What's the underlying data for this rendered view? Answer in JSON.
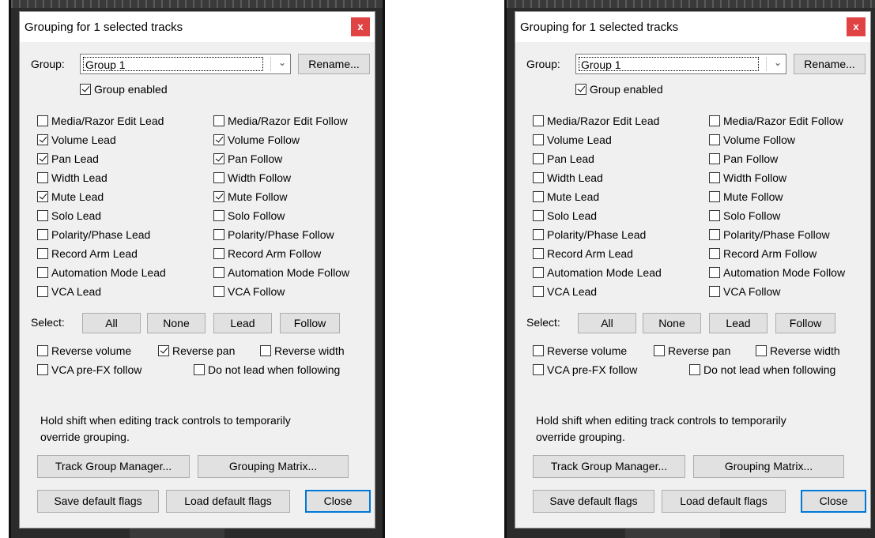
{
  "panels": [
    {
      "title": "Grouping for 1 selected tracks",
      "close_glyph": "x",
      "group_label": "Group:",
      "group_value": "Group 1",
      "rename_label": "Rename...",
      "group_enabled": {
        "label": "Group enabled",
        "checked": true
      },
      "flags": [
        {
          "lead": {
            "label": "Media/Razor Edit Lead",
            "checked": false
          },
          "follow": {
            "label": "Media/Razor Edit Follow",
            "checked": false
          }
        },
        {
          "lead": {
            "label": "Volume Lead",
            "checked": true
          },
          "follow": {
            "label": "Volume Follow",
            "checked": true
          }
        },
        {
          "lead": {
            "label": "Pan Lead",
            "checked": true
          },
          "follow": {
            "label": "Pan Follow",
            "checked": true
          }
        },
        {
          "lead": {
            "label": "Width Lead",
            "checked": false
          },
          "follow": {
            "label": "Width Follow",
            "checked": false
          }
        },
        {
          "lead": {
            "label": "Mute Lead",
            "checked": true
          },
          "follow": {
            "label": "Mute Follow",
            "checked": true
          }
        },
        {
          "lead": {
            "label": "Solo Lead",
            "checked": false
          },
          "follow": {
            "label": "Solo Follow",
            "checked": false
          }
        },
        {
          "lead": {
            "label": "Polarity/Phase Lead",
            "checked": false
          },
          "follow": {
            "label": "Polarity/Phase Follow",
            "checked": false
          }
        },
        {
          "lead": {
            "label": "Record Arm Lead",
            "checked": false
          },
          "follow": {
            "label": "Record Arm Follow",
            "checked": false
          }
        },
        {
          "lead": {
            "label": "Automation Mode Lead",
            "checked": false
          },
          "follow": {
            "label": "Automation Mode Follow",
            "checked": false
          }
        },
        {
          "lead": {
            "label": "VCA Lead",
            "checked": false
          },
          "follow": {
            "label": "VCA Follow",
            "checked": false
          }
        }
      ],
      "select_label": "Select:",
      "select_buttons": [
        "All",
        "None",
        "Lead",
        "Follow"
      ],
      "reverse_volume": {
        "label": "Reverse volume",
        "checked": false
      },
      "reverse_pan": {
        "label": "Reverse pan",
        "checked": true
      },
      "reverse_width": {
        "label": "Reverse width",
        "checked": false
      },
      "vca_prefx": {
        "label": "VCA pre-FX follow",
        "checked": false
      },
      "no_lead_following": {
        "label": "Do not lead when following",
        "checked": false
      },
      "note_line1": "Hold shift when editing track controls to temporarily",
      "note_line2": "override grouping.",
      "track_group_manager": "Track Group Manager...",
      "grouping_matrix": "Grouping Matrix...",
      "save_default": "Save default flags",
      "load_default": "Load default flags",
      "close_label": "Close"
    },
    {
      "title": "Grouping for 1 selected tracks",
      "close_glyph": "x",
      "group_label": "Group:",
      "group_value": "Group 1",
      "rename_label": "Rename...",
      "group_enabled": {
        "label": "Group enabled",
        "checked": true
      },
      "flags": [
        {
          "lead": {
            "label": "Media/Razor Edit Lead",
            "checked": false
          },
          "follow": {
            "label": "Media/Razor Edit Follow",
            "checked": false
          }
        },
        {
          "lead": {
            "label": "Volume Lead",
            "checked": false
          },
          "follow": {
            "label": "Volume Follow",
            "checked": false
          }
        },
        {
          "lead": {
            "label": "Pan Lead",
            "checked": false
          },
          "follow": {
            "label": "Pan Follow",
            "checked": false
          }
        },
        {
          "lead": {
            "label": "Width Lead",
            "checked": false
          },
          "follow": {
            "label": "Width Follow",
            "checked": false
          }
        },
        {
          "lead": {
            "label": "Mute Lead",
            "checked": false
          },
          "follow": {
            "label": "Mute Follow",
            "checked": false
          }
        },
        {
          "lead": {
            "label": "Solo Lead",
            "checked": false
          },
          "follow": {
            "label": "Solo Follow",
            "checked": false
          }
        },
        {
          "lead": {
            "label": "Polarity/Phase Lead",
            "checked": false
          },
          "follow": {
            "label": "Polarity/Phase Follow",
            "checked": false
          }
        },
        {
          "lead": {
            "label": "Record Arm Lead",
            "checked": false
          },
          "follow": {
            "label": "Record Arm Follow",
            "checked": false
          }
        },
        {
          "lead": {
            "label": "Automation Mode Lead",
            "checked": false
          },
          "follow": {
            "label": "Automation Mode Follow",
            "checked": false
          }
        },
        {
          "lead": {
            "label": "VCA Lead",
            "checked": false
          },
          "follow": {
            "label": "VCA Follow",
            "checked": false
          }
        }
      ],
      "select_label": "Select:",
      "select_buttons": [
        "All",
        "None",
        "Lead",
        "Follow"
      ],
      "reverse_volume": {
        "label": "Reverse volume",
        "checked": false
      },
      "reverse_pan": {
        "label": "Reverse pan",
        "checked": false
      },
      "reverse_width": {
        "label": "Reverse width",
        "checked": false
      },
      "vca_prefx": {
        "label": "VCA pre-FX follow",
        "checked": false
      },
      "no_lead_following": {
        "label": "Do not lead when following",
        "checked": false
      },
      "note_line1": "Hold shift when editing track controls to temporarily",
      "note_line2": "override grouping.",
      "track_group_manager": "Track Group Manager...",
      "grouping_matrix": "Grouping Matrix...",
      "save_default": "Save default flags",
      "load_default": "Load default flags",
      "close_label": "Close"
    }
  ],
  "colors": {
    "close_button": "#e04343",
    "default_button_border": "#0078d7",
    "dialog_bg": "#f0f0f0"
  }
}
